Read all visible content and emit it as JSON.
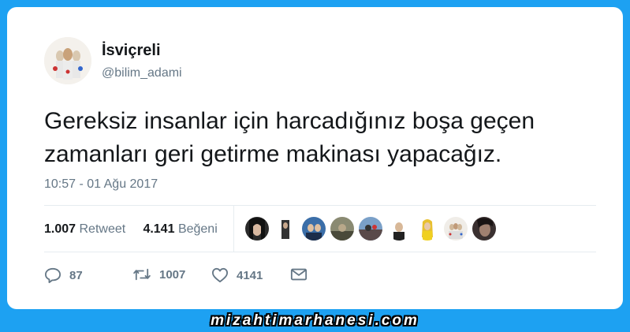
{
  "user": {
    "name": "İsviçreli",
    "handle": "@bilim_adami",
    "avatar_icon": "profile-picture-illustration"
  },
  "tweet": {
    "text": "Gereksiz insanlar için harcadığınız boşa geçen zamanları geri getirme makinası yapacağız.",
    "timestamp": "10:57 - 01 Ağu 2017"
  },
  "stats": {
    "retweets_count": "1.007",
    "retweets_label": "Retweet",
    "likes_count": "4.141",
    "likes_label": "Beğeni"
  },
  "likers": [
    "liker-avatar-1",
    "liker-avatar-2",
    "liker-avatar-3",
    "liker-avatar-4",
    "liker-avatar-5",
    "liker-avatar-6",
    "liker-avatar-7",
    "liker-avatar-8",
    "liker-avatar-9"
  ],
  "actions": {
    "reply_count": "87",
    "retweet_count": "1007",
    "like_count": "4141",
    "message_icon": "envelope-icon"
  },
  "watermark": "mizahtimarhanesi.com",
  "colors": {
    "frame": "#1da1f2",
    "text": "#14171a",
    "muted": "#657786",
    "divider": "#e6ecf0"
  }
}
